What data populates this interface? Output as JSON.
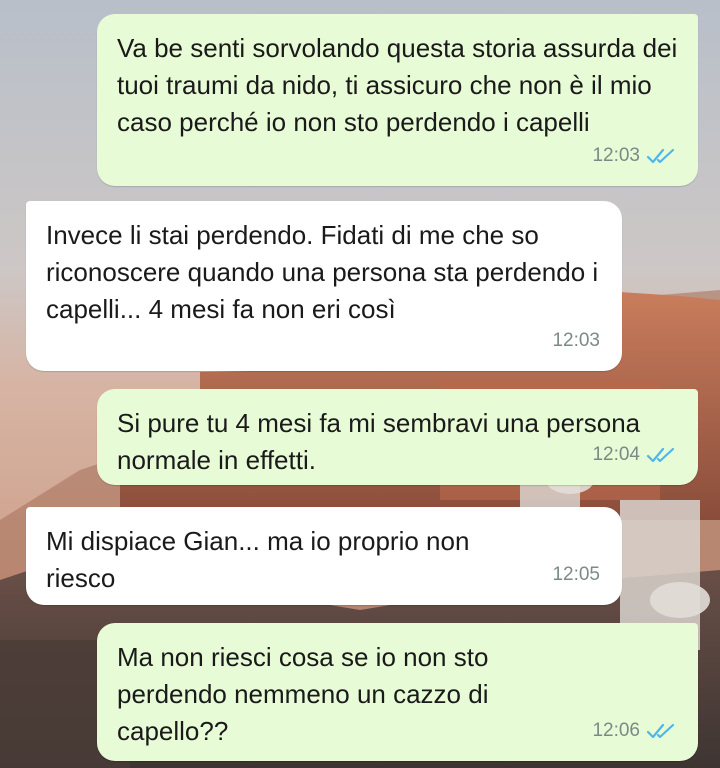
{
  "messages": [
    {
      "direction": "outgoing",
      "text": "Va be senti sorvolando questa storia assurda dei tuoi traumi da nido, ti assicuro che non è il mio caso perché io non sto perdendo i capelli",
      "time": "12:03",
      "status": "read"
    },
    {
      "direction": "incoming",
      "text": "Invece li stai perdendo. Fidati di me che so riconoscere quando una persona sta perdendo i capelli... 4 mesi fa non eri così",
      "time": "12:03"
    },
    {
      "direction": "outgoing",
      "text": "Si pure tu 4 mesi fa mi sembravi una persona normale in effetti.",
      "time": "12:04",
      "status": "read"
    },
    {
      "direction": "incoming",
      "text": "Mi dispiace Gian... ma io proprio non riesco",
      "time": "12:05"
    },
    {
      "direction": "outgoing",
      "text": "Ma non riesci cosa se io non sto perdendo nemmeno un cazzo di capello??",
      "time": "12:06",
      "status": "read"
    }
  ],
  "colors": {
    "outgoing_bubble": "#e8fbd7",
    "incoming_bubble": "#ffffff",
    "read_ticks": "#4fb6ec",
    "timestamp": "#7c8a86"
  },
  "icons": {
    "read_status": "double-check-icon"
  }
}
